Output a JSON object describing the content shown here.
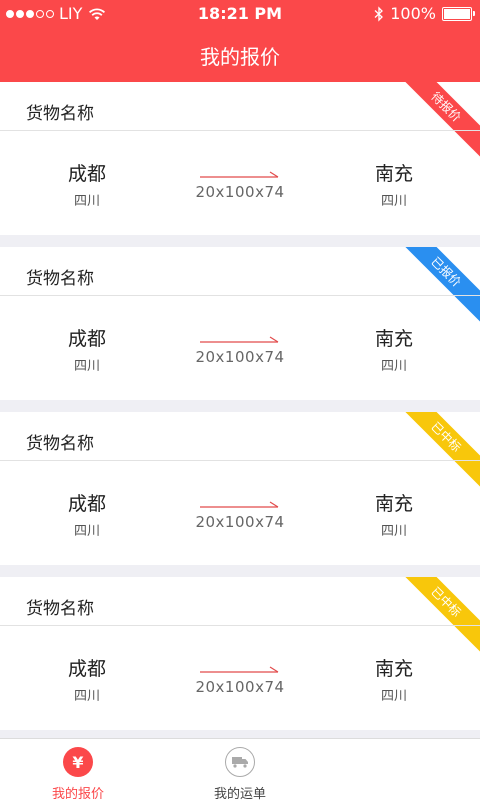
{
  "status_bar": {
    "carrier": "LIY",
    "time": "18:21 PM",
    "battery": "100%",
    "signal_bars": 3,
    "battery_level": 1.0
  },
  "nav": {
    "title": "我的报价"
  },
  "cards": [
    {
      "title": "货物名称",
      "from_city": "成都",
      "from_province": "四川",
      "to_city": "南充",
      "to_province": "四川",
      "dims": "20x100x74",
      "status": "待报价"
    },
    {
      "title": "货物名称",
      "from_city": "成都",
      "from_province": "四川",
      "to_city": "南充",
      "to_province": "四川",
      "dims": "20x100x74",
      "status": "已报价"
    },
    {
      "title": "货物名称",
      "from_city": "成都",
      "from_province": "四川",
      "to_city": "南充",
      "to_province": "四川",
      "dims": "20x100x74",
      "status": "已中标"
    },
    {
      "title": "货物名称",
      "from_city": "成都",
      "from_province": "四川",
      "to_city": "南充",
      "to_province": "四川",
      "dims": "20x100x74",
      "status": "已中标"
    }
  ],
  "tabbar": {
    "quote_label": "我的报价",
    "quote_icon_glyph": "¥",
    "orders_label": "我的运单"
  },
  "colors": {
    "accent": "#fb484a",
    "ribbon_pending": "#fb484a",
    "ribbon_quoted": "#2a8ff0",
    "ribbon_won": "#f8c70b",
    "background": "#efeff4"
  }
}
